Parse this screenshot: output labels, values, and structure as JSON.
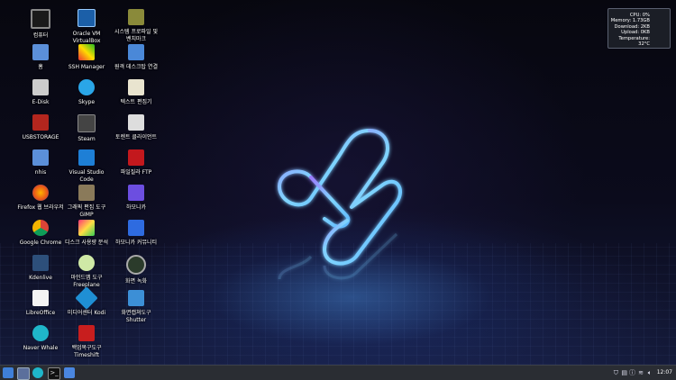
{
  "desktop": {
    "icons": [
      {
        "label": "컴퓨터",
        "icon": "computer-icon"
      },
      {
        "label": "홈",
        "icon": "home-folder-icon"
      },
      {
        "label": "E-Disk",
        "icon": "drive-icon"
      },
      {
        "label": "USBSTORAGE",
        "icon": "usb-storage-icon"
      },
      {
        "label": "nhis",
        "icon": "folder-icon"
      },
      {
        "label": "Firefox 웹 브라우저",
        "icon": "firefox-icon"
      },
      {
        "label": "Google Chrome",
        "icon": "chrome-icon"
      },
      {
        "label": "Kdenlive",
        "icon": "kdenlive-icon"
      },
      {
        "label": "LibreOffice",
        "icon": "libreoffice-icon"
      },
      {
        "label": "Naver Whale",
        "icon": "whale-icon"
      },
      {
        "label": "Oracle VM\nVirtualBox",
        "icon": "virtualbox-icon"
      },
      {
        "label": "SSH Manager",
        "icon": "ssh-manager-icon"
      },
      {
        "label": "Skype",
        "icon": "skype-icon"
      },
      {
        "label": "Steam",
        "icon": "steam-icon"
      },
      {
        "label": "Visual Studio\nCode",
        "icon": "vscode-icon"
      },
      {
        "label": "그래픽 편집 도구\nGIMP",
        "icon": "gimp-icon"
      },
      {
        "label": "디스크 사용량 분석",
        "icon": "disk-usage-icon"
      },
      {
        "label": "마인드맵 도구\nFreeplane",
        "icon": "freeplane-icon"
      },
      {
        "label": "미디어센터 Kodi",
        "icon": "kodi-icon"
      },
      {
        "label": "백업복구도구\nTimeshift",
        "icon": "timeshift-icon"
      },
      {
        "label": "시스템 프로파일 및\n벤치마크",
        "icon": "system-profiler-icon"
      },
      {
        "label": "원격 데스크탑 연결",
        "icon": "remote-desktop-icon"
      },
      {
        "label": "텍스트 편집기",
        "icon": "text-editor-icon"
      },
      {
        "label": "토렌트 클라이언트",
        "icon": "torrent-icon"
      },
      {
        "label": "파일질라 FTP",
        "icon": "filezilla-icon"
      },
      {
        "label": "하모니카",
        "icon": "harmonica-icon"
      },
      {
        "label": "하모니카 커뮤니티",
        "icon": "harmonica-community-icon"
      },
      {
        "label": "화면 녹화",
        "icon": "screen-recorder-icon"
      },
      {
        "label": "화면캡쳐도구\nShutter",
        "icon": "shutter-icon"
      }
    ]
  },
  "monitor": {
    "cpu": "CPU: 0%",
    "memory": "Memory: 1.73GB",
    "download": "Download: 2KB",
    "upload": "Upload: 0KB",
    "temperature": "Temperature: 32°C"
  },
  "taskbar": {
    "clock": "12:07",
    "launchers": [
      "menu-icon",
      "show-desktop-icon",
      "whale-icon",
      "terminal-icon",
      "file-manager-icon"
    ]
  },
  "colors": {
    "accent": "#4aa3ff",
    "logo_glow_1": "#7fd4ff",
    "logo_glow_2": "#b07cff",
    "taskbar": "#2a2d33"
  }
}
